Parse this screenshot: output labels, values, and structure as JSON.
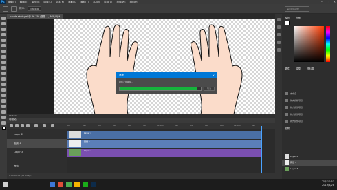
{
  "menu": [
    "檔案(F)",
    "編輯(E)",
    "影像(I)",
    "圖層(L)",
    "文字(Y)",
    "選取(S)",
    "濾鏡(T)",
    "3D(D)",
    "檢視(V)",
    "視窗(W)",
    "說明(H)"
  ],
  "window_controls": [
    "–",
    "□",
    "×"
  ],
  "options": {
    "sample_label": "樣本:",
    "sample_value": "目前圖層",
    "search_placeholder": "探索所有功能"
  },
  "document_tab": "hands sketcyel @ 66.7% (圖層 1, RGB/8) *",
  "status_text": "66.67%",
  "dialog": {
    "title": "進度",
    "message": "視訊正在轉譯...",
    "cancel": "取消",
    "progress": 0.95
  },
  "timeline": {
    "title": "時間軸",
    "ruler": [
      "00",
      "02f",
      "04f",
      "06f",
      "08f",
      "10f",
      "01:00f",
      "02f",
      "04f",
      "06f",
      "08f",
      "02:00f",
      "02f"
    ],
    "layers": [
      {
        "name": "Layer 2"
      },
      {
        "name": "圖層 1"
      },
      {
        "name": "Layer 3"
      }
    ],
    "clips": [
      {
        "label": "Layer 2"
      },
      {
        "label": "圖層 1"
      },
      {
        "label": "Layer 3"
      }
    ],
    "audio": "音軌",
    "footer": "0:00:00:02 (15.00 fps)"
  },
  "right_panel": {
    "color_tab": "顏色",
    "swatch_tab": "色票",
    "properties_tab": "屬性",
    "adjust_tab": "調整",
    "libraries_tab": "資料庫",
    "items": [
      "未命名",
      "新式調整項目",
      "新式調整項目",
      "新式調整項目",
      "新式調整項目"
    ],
    "layers_tab": "圖層",
    "layers": [
      "Layer 2",
      "圖層 1",
      "Layer 3"
    ]
  },
  "taskbar": {
    "time": "下午 10:53",
    "date": "2019/8/28"
  },
  "colors": {
    "accent": "#0078d7",
    "progress": "#16b33c",
    "clip_blue": "#4a6fa5",
    "clip_purple": "#7a4fb0",
    "clip_layer": "#5b7fb8"
  }
}
